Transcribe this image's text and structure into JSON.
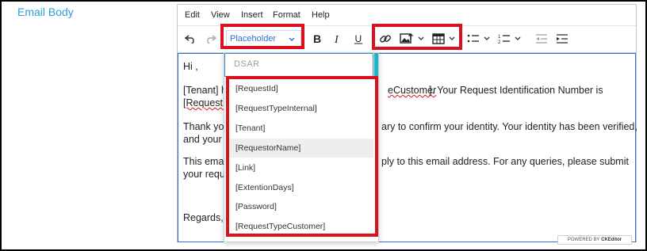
{
  "field_label": "Email Body",
  "menubar": {
    "items": [
      "Edit",
      "View",
      "Insert",
      "Format",
      "Help"
    ]
  },
  "toolbar": {
    "placeholder_dropdown": "Placeholder",
    "icons": [
      "undo-icon",
      "redo-icon",
      "bold-icon",
      "italic-icon",
      "underline-icon",
      "link-icon",
      "image-icon",
      "table-icon",
      "bullet-list-icon",
      "numbered-list-icon",
      "outdent-icon",
      "indent-icon"
    ]
  },
  "body": {
    "greeting": "Hi ,",
    "p1_start": "[Tenant] h",
    "p1_mid": "eCustomer",
    "p1_end": "].  Your Request Identification Number is",
    "p1_line2": "[RequestI",
    "p2_start": "Thank you",
    "p2_end": "ary to confirm your identity. Your identity has been verified,",
    "p2_line2": "and your",
    "p3_start": "This emai",
    "p3_end": "ply to this email address. For any queries, please submit",
    "p3_line2": "your requ",
    "closing": "Regards,"
  },
  "dropdown": {
    "header": "DSAR",
    "items": [
      "[RequestId]",
      "[RequestTypeInternal]",
      "[Tenant]",
      "[RequestorName]",
      "[Link]",
      "[ExtentionDays]",
      "[Password]",
      "[RequestTypeCustomer]"
    ],
    "hovered_index": 3
  },
  "powered_by": {
    "prefix": "POWERED BY",
    "brand": "CKEditor"
  },
  "colors": {
    "highlight": "#d9101e",
    "accent": "#2f6fd6",
    "label": "#2ba0d8"
  }
}
